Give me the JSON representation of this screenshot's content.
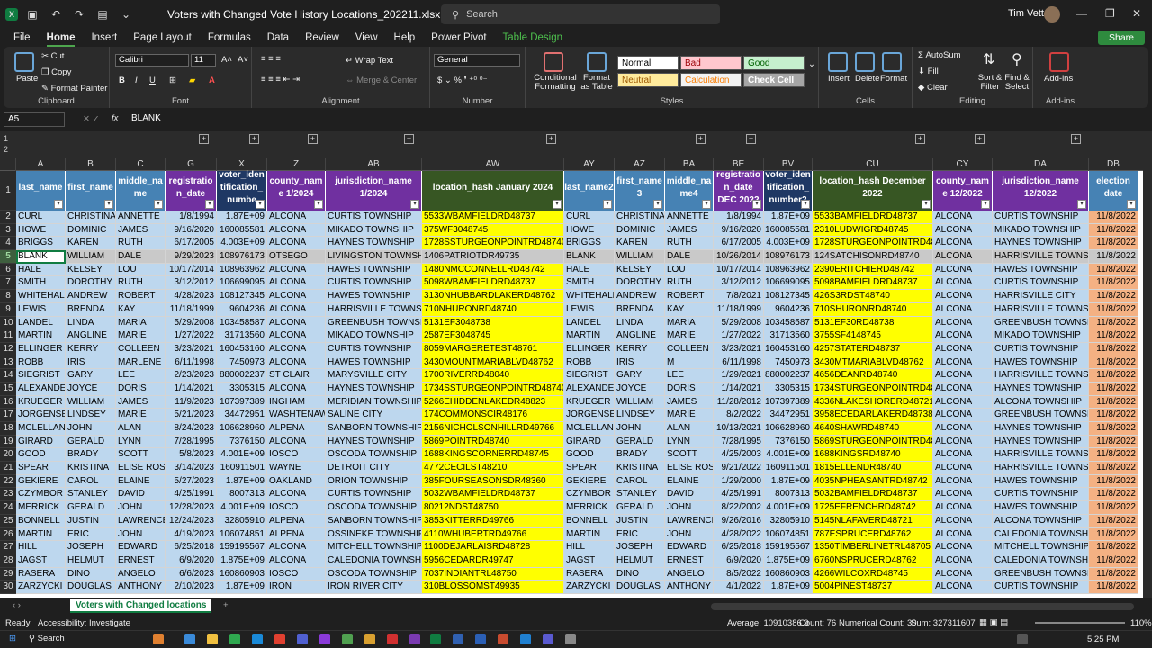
{
  "window": {
    "title": "Voters with Changed Vote History Locations_202211.xlsx  -  Excel",
    "search": "Search",
    "user": "Tim Vetter"
  },
  "tabs": [
    "File",
    "Home",
    "Insert",
    "Page Layout",
    "Formulas",
    "Data",
    "Review",
    "View",
    "Help",
    "Power Pivot",
    "Table Design"
  ],
  "share": "Share",
  "ribbon": {
    "clipboard": {
      "label": "Clipboard",
      "paste": "Paste",
      "cut": "Cut",
      "copy": "Copy",
      "painter": "Format Painter"
    },
    "font": {
      "label": "Font",
      "name": "Calibri",
      "size": "11"
    },
    "alignment": {
      "label": "Alignment",
      "wrap": "Wrap Text",
      "merge": "Merge & Center"
    },
    "number": {
      "label": "Number",
      "format": "General"
    },
    "styles": {
      "label": "Styles",
      "cond": "Conditional Formatting",
      "fmt_table": "Format as Table",
      "normal": "Normal",
      "bad": "Bad",
      "good": "Good",
      "neutral": "Neutral",
      "calc": "Calculation",
      "check": "Check Cell"
    },
    "cells": {
      "label": "Cells",
      "insert": "Insert",
      "delete": "Delete",
      "format": "Format"
    },
    "editing": {
      "label": "Editing",
      "autosum": "AutoSum",
      "fill": "Fill",
      "clear": "Clear",
      "sort": "Sort & Filter",
      "find": "Find & Select"
    },
    "addins": {
      "label": "Add-ins",
      "btn": "Add-ins"
    }
  },
  "formula": {
    "namebox": "A5",
    "content": "BLANK",
    "fx": "fx"
  },
  "outline_rows": [
    "1",
    "2"
  ],
  "columns": [
    "A",
    "B",
    "C",
    "G",
    "X",
    "Z",
    "AB",
    "AW",
    "AY",
    "AZ",
    "BA",
    "BE",
    "BV",
    "CU",
    "CY",
    "DA",
    "DB"
  ],
  "headers": [
    "last_name",
    "first_name",
    "middle_na me",
    "registratio n_date",
    "voter_iden tification_ numbe",
    "county_nam e 1/2024",
    "jurisdiction_name 1/2024",
    "location_hash January 2024",
    "last_name2",
    "first_name 3",
    "middle_na me4",
    "registratio n_date DEC 2022",
    "voter_iden tification_ number2",
    "location_hash December 2022",
    "county_nam e 12/2022",
    "jurisdiction_name 12/2022",
    "election date"
  ],
  "rows": [
    [
      "CURL",
      "CHRISTINA",
      "ANNETTE",
      "1/8/1994",
      "1.87E+09",
      "ALCONA",
      "CURTIS TOWNSHIP",
      "5533WBAMFIELDRD48737",
      "CURL",
      "CHRISTINA",
      "ANNETTE",
      "1/8/1994",
      "1.87E+09",
      "5533BAMFIELDRD48737",
      "ALCONA",
      "CURTIS TOWNSHIP",
      "11/8/2022"
    ],
    [
      "HOWE",
      "DOMINIC",
      "JAMES",
      "9/16/2020",
      "160085581",
      "ALCONA",
      "MIKADO TOWNSHIP",
      "375WF3048745",
      "HOWE",
      "DOMINIC",
      "JAMES",
      "9/16/2020",
      "160085581",
      "2310LUDWIGRD48745",
      "ALCONA",
      "MIKADO TOWNSHIP",
      "11/8/2022"
    ],
    [
      "BRIGGS",
      "KAREN",
      "RUTH",
      "6/17/2005",
      "4.003E+09",
      "ALCONA",
      "HAYNES TOWNSHIP",
      "1728SSTURGEONPOINTRD48740",
      "BRIGGS",
      "KAREN",
      "RUTH",
      "6/17/2005",
      "4.003E+09",
      "1728STURGEONPOINTRD48740",
      "ALCONA",
      "HAYNES TOWNSHIP",
      "11/8/2022"
    ],
    [
      "BLANK",
      "WILLIAM",
      "DALE",
      "9/29/2023",
      "108976173",
      "OTSEGO",
      "LIVINGSTON TOWNSHIP",
      "1406PATRIOTDR49735",
      "BLANK",
      "WILLIAM",
      "DALE",
      "10/26/2014",
      "108976173",
      "124SATCHISONRD48740",
      "ALCONA",
      "HARRISVILLE TOWNSHIP",
      "11/8/2022"
    ],
    [
      "HALE",
      "KELSEY",
      "LOU",
      "10/17/2014",
      "108963962",
      "ALCONA",
      "HAWES TOWNSHIP",
      "1480NMCCONNELLRD48742",
      "HALE",
      "KELSEY",
      "LOU",
      "10/17/2014",
      "108963962",
      "2390ERITCHIERD48742",
      "ALCONA",
      "HAWES TOWNSHIP",
      "11/8/2022"
    ],
    [
      "SMITH",
      "DOROTHY",
      "RUTH",
      "3/12/2012",
      "106699095",
      "ALCONA",
      "CURTIS TOWNSHIP",
      "5098WBAMFIELDRD48737",
      "SMITH",
      "DOROTHY",
      "RUTH",
      "3/12/2012",
      "106699095",
      "5098BAMFIELDRD48737",
      "ALCONA",
      "CURTIS TOWNSHIP",
      "11/8/2022"
    ],
    [
      "WHITEHALL",
      "ANDREW",
      "ROBERT",
      "4/28/2023",
      "108127345",
      "ALCONA",
      "HAWES TOWNSHIP",
      "3130NHUBBARDLAKERD48762",
      "WHITEHALL",
      "ANDREW",
      "ROBERT",
      "7/8/2021",
      "108127345",
      "426S3RDST48740",
      "ALCONA",
      "HARRISVILLE CITY",
      "11/8/2022"
    ],
    [
      "LEWIS",
      "BRENDA",
      "KAY",
      "11/18/1999",
      "9604236",
      "ALCONA",
      "HARRISVILLE TOWNSHIP",
      "710NHURONRD48740",
      "LEWIS",
      "BRENDA",
      "KAY",
      "11/18/1999",
      "9604236",
      "710SHURONRD48740",
      "ALCONA",
      "HARRISVILLE TOWNSHIP",
      "11/8/2022"
    ],
    [
      "LANDEL",
      "LINDA",
      "MARIA",
      "5/29/2008",
      "103458587",
      "ALCONA",
      "GREENBUSH TOWNSHIP",
      "5131EF3048738",
      "LANDEL",
      "LINDA",
      "MARIA",
      "5/29/2008",
      "103458587",
      "5131EF30RD48738",
      "ALCONA",
      "GREENBUSH TOWNSHIP",
      "11/8/2022"
    ],
    [
      "MARTIN",
      "ANGLINE",
      "MARIE",
      "1/27/2022",
      "31713560",
      "ALCONA",
      "MIKADO TOWNSHIP",
      "2587EF3048745",
      "MARTIN",
      "ANGLINE",
      "MARIE",
      "1/27/2022",
      "31713560",
      "3755SF4148745",
      "ALCONA",
      "MIKADO TOWNSHIP",
      "11/8/2022"
    ],
    [
      "ELLINGER",
      "KERRY",
      "COLLEEN",
      "3/23/2021",
      "160453160",
      "ALCONA",
      "CURTIS TOWNSHIP",
      "8059MARGERETEST48761",
      "ELLINGER",
      "KERRY",
      "COLLEEN",
      "3/23/2021",
      "160453160",
      "4257STATERD48737",
      "ALCONA",
      "CURTIS TOWNSHIP",
      "11/8/2022"
    ],
    [
      "ROBB",
      "IRIS",
      "MARLENE",
      "6/11/1998",
      "7450973",
      "ALCONA",
      "HAWES TOWNSHIP",
      "3430MOUNTMARIABLVD48762",
      "ROBB",
      "IRIS",
      "M",
      "6/11/1998",
      "7450973",
      "3430MTMARIABLVD48762",
      "ALCONA",
      "HAWES TOWNSHIP",
      "11/8/2022"
    ],
    [
      "SIEGRIST",
      "GARY",
      "LEE",
      "2/23/2023",
      "880002237",
      "ST CLAIR",
      "MARYSVILLE CITY",
      "1700RIVERRD48040",
      "SIEGRIST",
      "GARY",
      "LEE",
      "1/29/2021",
      "880002237",
      "4656DEANRD48740",
      "ALCONA",
      "HARRISVILLE TOWNSHIP",
      "11/8/2022"
    ],
    [
      "ALEXANDER",
      "JOYCE",
      "DORIS",
      "1/14/2021",
      "3305315",
      "ALCONA",
      "HAYNES TOWNSHIP",
      "1734SSTURGEONPOINTRD48740",
      "ALEXANDER",
      "JOYCE",
      "DORIS",
      "1/14/2021",
      "3305315",
      "1734STURGEONPOINTRD48740",
      "ALCONA",
      "HAYNES TOWNSHIP",
      "11/8/2022"
    ],
    [
      "KRUEGER",
      "WILLIAM",
      "JAMES",
      "11/9/2023",
      "107397389",
      "INGHAM",
      "MERIDIAN TOWNSHIP",
      "5266EHIDDENLAKEDR48823",
      "KRUEGER",
      "WILLIAM",
      "JAMES",
      "11/28/2012",
      "107397389",
      "4336NLAKESHORERD48721",
      "ALCONA",
      "ALCONA TOWNSHIP",
      "11/8/2022"
    ],
    [
      "JORGENSEN",
      "LINDSEY",
      "MARIE",
      "5/21/2023",
      "34472951",
      "WASHTENAW",
      "SALINE CITY",
      "174COMMONSCIR48176",
      "JORGENSEN",
      "LINDSEY",
      "MARIE",
      "8/2/2022",
      "34472951",
      "3958ECEDARLAKERD48738",
      "ALCONA",
      "GREENBUSH TOWNSHIP",
      "11/8/2022"
    ],
    [
      "MCLELLAN",
      "JOHN",
      "ALAN",
      "8/24/2023",
      "106628960",
      "ALPENA",
      "SANBORN TOWNSHIP",
      "2156NICHOLSONHILLRD49766",
      "MCLELLAN",
      "JOHN",
      "ALAN",
      "10/13/2021",
      "106628960",
      "4640SHAWRD48740",
      "ALCONA",
      "HAYNES TOWNSHIP",
      "11/8/2022"
    ],
    [
      "GIRARD",
      "GERALD",
      "LYNN",
      "7/28/1995",
      "7376150",
      "ALCONA",
      "HAYNES TOWNSHIP",
      "5869POINTRD48740",
      "GIRARD",
      "GERALD",
      "LYNN",
      "7/28/1995",
      "7376150",
      "5869STURGEONPOINTRD48740",
      "ALCONA",
      "HAYNES TOWNSHIP",
      "11/8/2022"
    ],
    [
      "GOOD",
      "BRADY",
      "SCOTT",
      "5/8/2023",
      "4.001E+09",
      "IOSCO",
      "OSCODA TOWNSHIP",
      "1688KINGSCORNERRD48745",
      "GOOD",
      "BRADY",
      "SCOTT",
      "4/25/2003",
      "4.001E+09",
      "1688KINGSRD48740",
      "ALCONA",
      "HARRISVILLE TOWNSHIP",
      "11/8/2022"
    ],
    [
      "SPEAR",
      "KRISTINA",
      "ELISE ROSE",
      "3/14/2023",
      "160911501",
      "WAYNE",
      "DETROIT CITY",
      "4772CECILST48210",
      "SPEAR",
      "KRISTINA",
      "ELISE ROSE",
      "9/21/2022",
      "160911501",
      "1815ELLENDR48740",
      "ALCONA",
      "HARRISVILLE TOWNSHIP",
      "11/8/2022"
    ],
    [
      "GEKIERE",
      "CAROL",
      "ELAINE",
      "5/27/2023",
      "1.87E+09",
      "OAKLAND",
      "ORION TOWNSHIP",
      "385FOURSEASONSDR48360",
      "GEKIERE",
      "CAROL",
      "ELAINE",
      "1/29/2000",
      "1.87E+09",
      "4035NPHEASANTRD48742",
      "ALCONA",
      "HAWES TOWNSHIP",
      "11/8/2022"
    ],
    [
      "CZYMBOR",
      "STANLEY",
      "DAVID",
      "4/25/1991",
      "8007313",
      "ALCONA",
      "CURTIS TOWNSHIP",
      "5032WBAMFIELDRD48737",
      "CZYMBOR",
      "STANLEY",
      "DAVID",
      "4/25/1991",
      "8007313",
      "5032BAMFIELDRD48737",
      "ALCONA",
      "CURTIS TOWNSHIP",
      "11/8/2022"
    ],
    [
      "MERRICK",
      "GERALD",
      "JOHN",
      "12/28/2023",
      "4.001E+09",
      "IOSCO",
      "OSCODA TOWNSHIP",
      "80212NDST48750",
      "MERRICK",
      "GERALD",
      "JOHN",
      "8/22/2002",
      "4.001E+09",
      "1725EFRENCHRD48742",
      "ALCONA",
      "HAWES TOWNSHIP",
      "11/8/2022"
    ],
    [
      "BONNELL",
      "JUSTIN",
      "LAWRENCE",
      "12/24/2023",
      "32805910",
      "ALPENA",
      "SANBORN TOWNSHIP",
      "3853KITTERRD49766",
      "BONNELL",
      "JUSTIN",
      "LAWRENCE",
      "9/26/2016",
      "32805910",
      "5145NLAFAVERD48721",
      "ALCONA",
      "ALCONA TOWNSHIP",
      "11/8/2022"
    ],
    [
      "MARTIN",
      "ERIC",
      "JOHN",
      "4/19/2023",
      "106074851",
      "ALPENA",
      "OSSINEKE TOWNSHIP",
      "4110WHUBERTRD49766",
      "MARTIN",
      "ERIC",
      "JOHN",
      "4/28/2022",
      "106074851",
      "787ESPRUCERD48762",
      "ALCONA",
      "CALEDONIA TOWNSHIP",
      "11/8/2022"
    ],
    [
      "HILL",
      "JOSEPH",
      "EDWARD",
      "6/25/2018",
      "159195567",
      "ALCONA",
      "MITCHELL TOWNSHIP",
      "1100DEJARLAISRD48728",
      "HILL",
      "JOSEPH",
      "EDWARD",
      "6/25/2018",
      "159195567",
      "1350TIMBERLINETRL48705",
      "ALCONA",
      "MITCHELL TOWNSHIP",
      "11/8/2022"
    ],
    [
      "JAGST",
      "HELMUT",
      "ERNEST",
      "6/9/2020",
      "1.875E+09",
      "ALCONA",
      "CALEDONIA TOWNSHIP",
      "5956CEDARDR49747",
      "JAGST",
      "HELMUT",
      "ERNEST",
      "6/9/2020",
      "1.875E+09",
      "6760NSPRUCERD48762",
      "ALCONA",
      "CALEDONIA TOWNSHIP",
      "11/8/2022"
    ],
    [
      "RASERA",
      "DINO",
      "ANGELO",
      "6/6/2023",
      "160860903",
      "IOSCO",
      "OSCODA TOWNSHIP",
      "7037INDIANTRL48750",
      "RASERA",
      "DINO",
      "ANGELO",
      "8/5/2022",
      "160860903",
      "4266WILCOXRD48745",
      "ALCONA",
      "GREENBUSH TOWNSHIP",
      "11/8/2022"
    ],
    [
      "ZARZYCKI",
      "DOUGLAS",
      "ANTHONY",
      "2/10/2023",
      "1.87E+09",
      "IRON",
      "IRON RIVER CITY",
      "310BLOSSOMST49935",
      "ZARZYCKI",
      "DOUGLAS",
      "ANTHONY",
      "4/1/2022",
      "1.87E+09",
      "5004PINEST48737",
      "ALCONA",
      "CURTIS TOWNSHIP",
      "11/8/2022"
    ]
  ],
  "row_numbers": [
    "2",
    "3",
    "4",
    "5",
    "6",
    "7",
    "8",
    "9",
    "10",
    "11",
    "12",
    "13",
    "14",
    "15",
    "16",
    "17",
    "18",
    "19",
    "20",
    "21",
    "22",
    "23",
    "24",
    "25",
    "26",
    "27",
    "28",
    "29",
    "30"
  ],
  "sheet_tab": "Voters with Changed locations",
  "status": {
    "ready": "Ready",
    "access": "Accessibility: Investigate",
    "average": "Average: 10910386.9",
    "count": "Count: 76",
    "numcount": "Numerical Count: 30",
    "sum": "Sum: 327311607",
    "zoom": "110%"
  },
  "taskbar": {
    "search": "Search",
    "time": "5:25 PM"
  }
}
